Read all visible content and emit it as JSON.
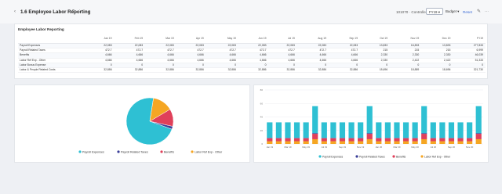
{
  "header": {
    "back_icon": "chevron-left-icon",
    "title": "1.6 Employee Labor Reporting",
    "gear_icon": "gear-icon",
    "share_icon": "share-icon",
    "company": "101070 · Controller",
    "period": "FY19",
    "scenario": "Budget",
    "reset": "Reset",
    "edit_icon": "pencil-icon",
    "more_icon": "more-icon"
  },
  "table": {
    "title": "Employee Labor Reporting",
    "columns": [
      "Jan 19",
      "Feb 19",
      "Mar 19",
      "Apr 19",
      "May 19",
      "Jun 19",
      "Jul 19",
      "Aug 19",
      "Sep 19",
      "Oct 19",
      "Nov 19",
      "Dec 19",
      "FY19"
    ],
    "rows": [
      {
        "label": "Payroll Expenses",
        "values": [
          "22,083",
          "22,083",
          "22,083",
          "22,083",
          "22,083",
          "22,083",
          "22,083",
          "22,083",
          "22,083",
          "13,833",
          "16,833",
          "13,833",
          "277,833"
        ]
      },
      {
        "label": "Payroll Related Taxes",
        "values": [
          "472.7",
          "472.7",
          "472.7",
          "472.7",
          "472.7",
          "472.7",
          "472.7",
          "472.7",
          "472.7",
          "215",
          "215",
          "215",
          "6,999"
        ]
      },
      {
        "label": "Benefits",
        "values": [
          "4,666",
          "4,666",
          "4,666",
          "4,666",
          "4,666",
          "4,666",
          "4,666",
          "4,666",
          "4,666",
          "2,330",
          "2,330",
          "2,330",
          "46,039"
        ]
      },
      {
        "label": "Labor Ref Exp - Other",
        "values": [
          "4,666",
          "4,666",
          "4,666",
          "4,666",
          "4,666",
          "4,666",
          "4,666",
          "4,666",
          "4,666",
          "2,330",
          "2,422",
          "2,422",
          "51,333"
        ]
      },
      {
        "label": "Labor Bonus Expense",
        "values": [
          "0",
          "0",
          "0",
          "0",
          "0",
          "0",
          "0",
          "0",
          "0",
          "0",
          "0",
          "0",
          "0"
        ]
      },
      {
        "label": "Labor & People Related Costs",
        "values": [
          "32,886",
          "32,886",
          "32,886",
          "32,886",
          "32,886",
          "32,886",
          "32,886",
          "32,886",
          "32,886",
          "18,696",
          "18,889",
          "18,696",
          "321,730"
        ]
      }
    ]
  },
  "colors": {
    "payroll": "#2ec0d3",
    "taxes": "#3b3f99",
    "benefits": "#e0405a",
    "other": "#f5a623",
    "accent": "#3b6bd6"
  },
  "pie": {
    "shares": [
      0.72,
      0.02,
      0.12,
      0.14
    ],
    "legend": [
      "Payroll Expenses",
      "Payroll Related Taxes",
      "Benefits",
      "Labor Ref Exp - Other"
    ]
  },
  "chart_data": {
    "type": "bar",
    "stacked": true,
    "categories": [
      "Jan 19",
      "Feb 19",
      "Mar 19",
      "Apr 19",
      "May 19",
      "Jun 19",
      "Jul 19",
      "Aug 19",
      "Sep 19",
      "Oct 19",
      "Nov 19",
      "Dec 19",
      "Jan 20",
      "Feb 20",
      "Mar 20",
      "Apr 20",
      "May 20",
      "Jun 20",
      "Jul 20",
      "Aug 20",
      "Sep 20",
      "Oct 20",
      "Nov 20",
      "Dec 20"
    ],
    "tick_labels": [
      "Jan 19",
      "",
      "Mar 19",
      "",
      "May 19",
      "",
      "Jul 19",
      "",
      "Sep 19",
      "",
      "Nov 19",
      "",
      "Jan 20",
      "",
      "Mar 20",
      "",
      "May 20",
      "",
      "Jul 20",
      "",
      "Sep 20",
      "",
      "Nov 20",
      ""
    ],
    "series": [
      {
        "name": "Payroll Expenses",
        "values": [
          23,
          23,
          23,
          23,
          23,
          40,
          23,
          23,
          23,
          23,
          23,
          40,
          23,
          23,
          23,
          23,
          23,
          40,
          23,
          23,
          23,
          23,
          23,
          40
        ]
      },
      {
        "name": "Payroll Related Taxes",
        "values": [
          0.5,
          0.5,
          0.5,
          0.5,
          0.5,
          1,
          0.5,
          0.5,
          0.5,
          0.5,
          0.5,
          1,
          0.5,
          0.5,
          0.5,
          0.5,
          0.5,
          1,
          0.5,
          0.5,
          0.5,
          0.5,
          0.5,
          1
        ]
      },
      {
        "name": "Benefits",
        "values": [
          4.5,
          4.5,
          4.5,
          4.5,
          4.5,
          8,
          4.5,
          4.5,
          4.5,
          4.5,
          4.5,
          8,
          4.5,
          4.5,
          4.5,
          4.5,
          4.5,
          8,
          4.5,
          4.5,
          4.5,
          4.5,
          4.5,
          8
        ]
      },
      {
        "name": "Labor Ref Exp - Other",
        "values": [
          4,
          4,
          4,
          4,
          4,
          7,
          4,
          4,
          4,
          4,
          4,
          7,
          4,
          4,
          4,
          4,
          4,
          7,
          4,
          4,
          4,
          4,
          4,
          7
        ]
      }
    ],
    "ylim": [
      0,
      80
    ],
    "yticks": [
      "80",
      "60",
      "40",
      "20",
      "0"
    ],
    "legend_position": "bottom"
  }
}
